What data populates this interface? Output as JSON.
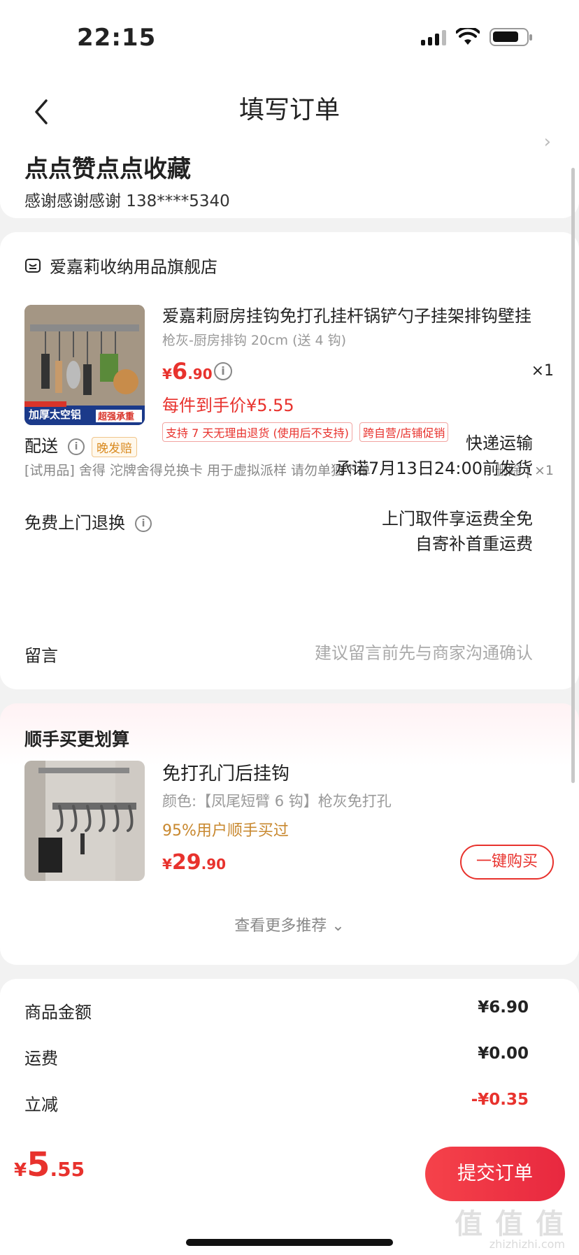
{
  "status": {
    "time": "22:15"
  },
  "nav": {
    "title": "填写订单"
  },
  "address": {
    "name": "点点赞点点收藏",
    "contact": "感谢感谢感谢  138****5340"
  },
  "shop": {
    "name": "爱嘉莉收纳用品旗舰店"
  },
  "product": {
    "title": "爱嘉莉厨房挂钩免打孔挂杆锅铲勺子挂架排钩壁挂",
    "spec": "枪灰-厨房排钩 20cm (送 4 钩)",
    "price_currency": "¥",
    "price_int": "6",
    "price_dec": ".90",
    "qty": "×1",
    "final_price": "每件到手价¥5.55",
    "tags": [
      "支持 7 天无理由退货 (使用后不支持)",
      "跨自营/店铺促销"
    ],
    "thumb_badge": "加厚太空铝",
    "thumb_badge2": "超强承重"
  },
  "trial": {
    "text": "[试用品] 舍得 沱牌舍得兑换卡 用于虚拟派样 请勿单独下单",
    "actions": "删除 | ×1"
  },
  "delivery": {
    "label": "配送",
    "badge": "晚发赔",
    "method": "快递运输",
    "promise": "承诺7月13日24:00前发货"
  },
  "returns": {
    "label": "免费上门退换",
    "line1": "上门取件享运费全免",
    "line2": "自寄补首重运费"
  },
  "note": {
    "label": "留言",
    "placeholder": "建议留言前先与商家沟通确认"
  },
  "recommend": {
    "title": "顺手买更划算",
    "name": "免打孔门后挂钩",
    "spec": "颜色:【凤尾短臂 6 钩】枪灰免打孔",
    "bought": "95%用户顺手买过",
    "price_currency": "¥",
    "price_int": "29",
    "price_dec": ".90",
    "button": "一键购买",
    "more": "查看更多推荐 ⌄"
  },
  "summary": {
    "goods_label": "商品金额",
    "goods_value": "¥6.90",
    "shipping_label": "运费",
    "shipping_value": "¥0.00",
    "discount_label": "立减",
    "discount_value": "-¥0.35"
  },
  "bottom": {
    "currency": "¥",
    "total_int": "5",
    "total_dec": ".55",
    "submit": "提交订单",
    "watermark": "值 值 值",
    "watermark_sub": "zhizhizhi.com"
  },
  "colors": {
    "accent": "#e8322d",
    "gold": "#c8882f"
  }
}
